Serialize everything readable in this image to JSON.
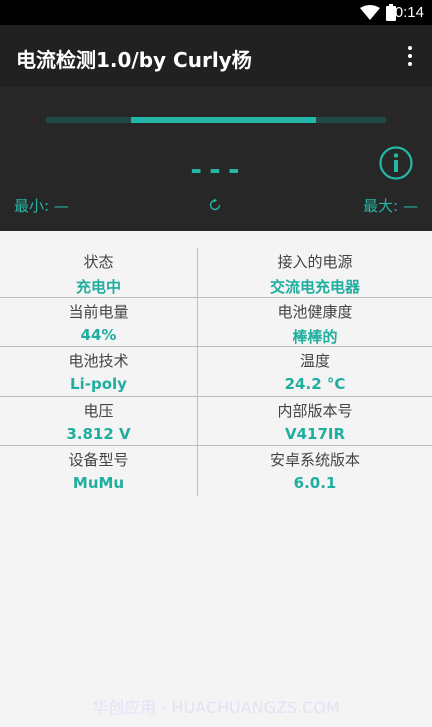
{
  "status_bar": {
    "time": "10:14",
    "icons": [
      "wifi-icon",
      "battery-icon"
    ]
  },
  "app_bar": {
    "title": "电流检测1.0/by Curly杨",
    "menu_icon": "overflow-menu-icon"
  },
  "meter": {
    "level": 0.55,
    "value": "---",
    "min_label": "最小: —",
    "max_label": "最大: —",
    "info_icon": "info-icon",
    "refresh_icon": "refresh-icon"
  },
  "grid": {
    "rows": [
      {
        "left_label": "状态",
        "left_value": "充电中",
        "right_label": "接入的电源",
        "right_value": "交流电充电器"
      },
      {
        "left_label": "当前电量",
        "left_value": "44%",
        "right_label": "电池健康度",
        "right_value": "棒棒的"
      },
      {
        "left_label": "电池技术",
        "left_value": "Li-poly",
        "right_label": "温度",
        "right_value": "24.2 °C"
      },
      {
        "left_label": "电压",
        "left_value": "3.812 V",
        "right_label": "内部版本号",
        "right_value": "V417IR"
      },
      {
        "left_label": "设备型号",
        "left_value": "MuMu",
        "right_label": "安卓系统版本",
        "right_value": "6.0.1"
      }
    ]
  },
  "watermark": "华创应用 · HUACHUANGZS.COM",
  "colors": {
    "accent": "#26b6a6",
    "appbar": "#212121",
    "meter_bg": "#272727"
  }
}
